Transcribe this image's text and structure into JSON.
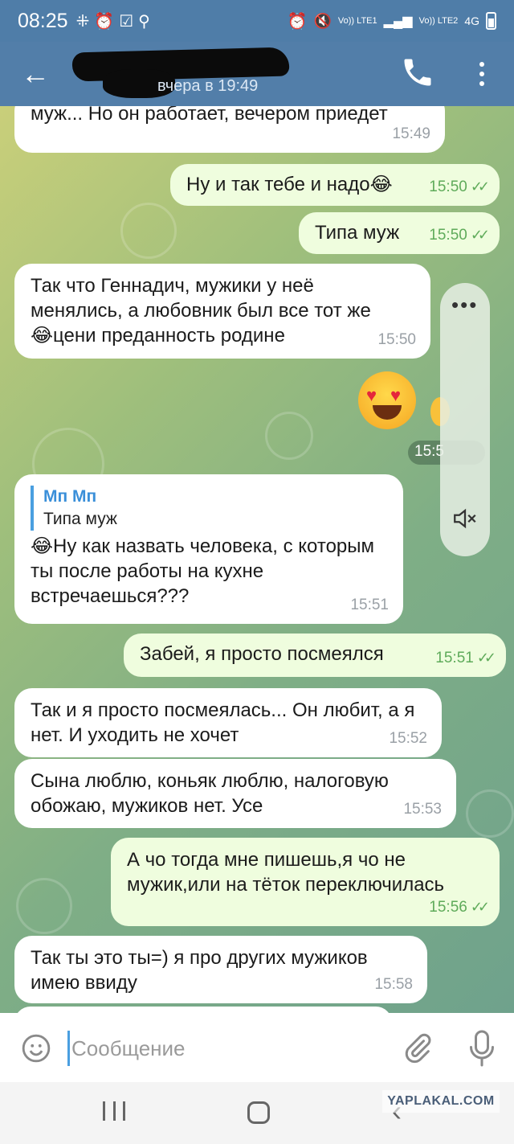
{
  "status_bar": {
    "time": "08:25",
    "signal_1": "Vo)) LTE1",
    "signal_2": "Vo)) LTE2",
    "network": "4G"
  },
  "header": {
    "last_seen": "вчера в 19:49"
  },
  "messages": [
    {
      "direction": "in",
      "text": "муж... Но он работает, вечером приедет",
      "time": "15:49"
    },
    {
      "direction": "out",
      "text": "Ну и так тебе и надо😂",
      "time": "15:50"
    },
    {
      "direction": "out",
      "text": "Типа муж",
      "time": "15:50"
    },
    {
      "direction": "in",
      "text": "Так что Геннадич, мужики у неё менялись, а любовник был все тот же 😂цени преданность родине",
      "time": "15:50"
    },
    {
      "direction": "out",
      "sticker": "heart-eyes-emoji",
      "time": "15:5"
    },
    {
      "direction": "in",
      "reply_name": "Мп Мп",
      "reply_text": "Типа муж",
      "text": "😂Ну как назвать человека, с которым ты после работы на кухне встречаешься???",
      "time": "15:51"
    },
    {
      "direction": "out",
      "text": "Забей, я просто посмеялся",
      "time": "15:51"
    },
    {
      "direction": "in",
      "text": "Так и я просто посмеялась... Он любит, а я нет. И уходить не хочет",
      "time": "15:52"
    },
    {
      "direction": "in",
      "text": "Сына люблю, коньяк люблю, налоговую обожаю, мужиков нет. Усе",
      "time": "15:53"
    },
    {
      "direction": "out",
      "text": "А чо тогда мне пишешь,я чо не мужик,или на тёток переключилась",
      "time": "15:56"
    },
    {
      "direction": "in",
      "text": "Так ты это ты=) я про других мужиков имею ввиду",
      "time": "15:58"
    }
  ],
  "input": {
    "placeholder": "Сообщение"
  },
  "watermark": "YAPLAKAL.COM",
  "colors": {
    "header": "#527ea9",
    "outgoing_bubble": "#effdde",
    "incoming_bubble": "#ffffff",
    "check": "#5fab5a",
    "reply_accent": "#3a8fd9"
  }
}
